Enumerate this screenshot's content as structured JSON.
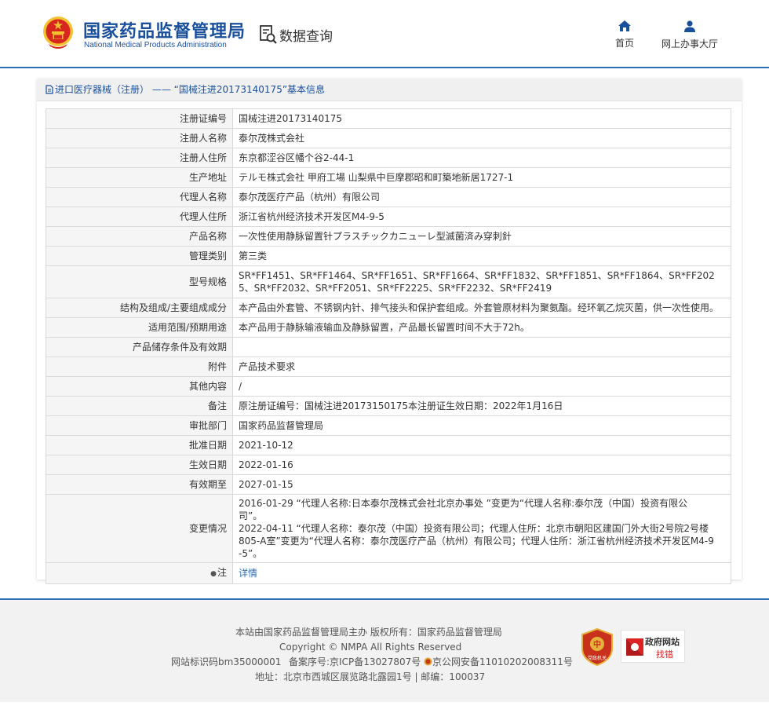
{
  "header": {
    "brand_cn": "国家药品监督管理局",
    "brand_en": "National Medical Products Administration",
    "query_label": "数据查询",
    "nav": [
      {
        "label": "首页",
        "icon": "home-icon"
      },
      {
        "label": "网上办事大厅",
        "icon": "user-icon"
      }
    ]
  },
  "panel": {
    "title": "进口医疗器械（注册） —— “国械注进20173140175”基本信息"
  },
  "rows": [
    {
      "key": "注册证编号",
      "value": "国械注进20173140175"
    },
    {
      "key": "注册人名称",
      "value": "泰尔茂株式会社"
    },
    {
      "key": "注册人住所",
      "value": "东京都涩谷区幡个谷2-44-1"
    },
    {
      "key": "生产地址",
      "value": "テルモ株式会社 甲府工場 山梨県中巨摩郡昭和町築地新居1727-1"
    },
    {
      "key": "代理人名称",
      "value": "泰尔茂医疗产品（杭州）有限公司"
    },
    {
      "key": "代理人住所",
      "value": "浙江省杭州经济技术开发区M4-9-5"
    },
    {
      "key": "产品名称",
      "value": "一次性使用静脉留置针プラスチックカニューレ型滅菌済み穿刺針"
    },
    {
      "key": "管理类别",
      "value": "第三类"
    },
    {
      "key": "型号规格",
      "value": "SR*FF1451、SR*FF1464、SR*FF1651、SR*FF1664、SR*FF1832、SR*FF1851、SR*FF1864、SR*FF2025、SR*FF2032、SR*FF2051、SR*FF2225、SR*FF2232、SR*FF2419"
    },
    {
      "key": "结构及组成/主要组成成分",
      "value": "本产品由外套管、不锈钢内针、排气接头和保护套组成。外套管原材料为聚氨酯。经环氧乙烷灭菌，供一次性使用。"
    },
    {
      "key": "适用范围/预期用途",
      "value": "本产品用于静脉输液输血及静脉留置，产品最长留置时间不大于72h。"
    },
    {
      "key": "产品储存条件及有效期",
      "value": ""
    },
    {
      "key": "附件",
      "value": "产品技术要求"
    },
    {
      "key": "其他内容",
      "value": "/"
    },
    {
      "key": "备注",
      "value": "原注册证编号：国械注进20173150175本注册证生效日期：2022年1月16日"
    },
    {
      "key": "审批部门",
      "value": "国家药品监督管理局"
    },
    {
      "key": "批准日期",
      "value": "2021-10-12"
    },
    {
      "key": "生效日期",
      "value": "2022-01-16"
    },
    {
      "key": "有效期至",
      "value": "2027-01-15"
    }
  ],
  "change": {
    "key": "变更情况",
    "line1": "2016-01-29 “代理人名称:日本泰尔茂株式会社北京办事处 ”变更为“代理人名称:泰尔茂（中国）投资有限公司”。",
    "line2": "2022-04-11 “代理人名称：泰尔茂（中国）投资有限公司；代理人住所：北京市朝阳区建国门外大街2号院2号楼805-A室”变更为“代理人名称：泰尔茂医疗产品（杭州）有限公司；代理人住所：浙江省杭州经济技术开发区M4-9-5”。"
  },
  "note": {
    "key": "注",
    "value": "详情"
  },
  "footer": {
    "line1": "本站由国家药品监督管理局主办 版权所有：国家药品监督管理局",
    "line2": "Copyright © NMPA All Rights Reserved",
    "line3a": "网站标识码bm35000001",
    "line3b": "备案序号:京ICP备13027807号",
    "line3c": "京公网安备11010202008311号",
    "line4": "地址：北京市西城区展览路北露园1号 | 邮编：100037",
    "badge1_text": "党政机关",
    "badge2_top": "政府网站",
    "badge2_bottom": "找错"
  },
  "colors": {
    "brand_blue": "#1a4f9c",
    "accent_blue": "#2d6fb6",
    "emblem_red": "#d7261e",
    "emblem_gold": "#f2c230"
  }
}
